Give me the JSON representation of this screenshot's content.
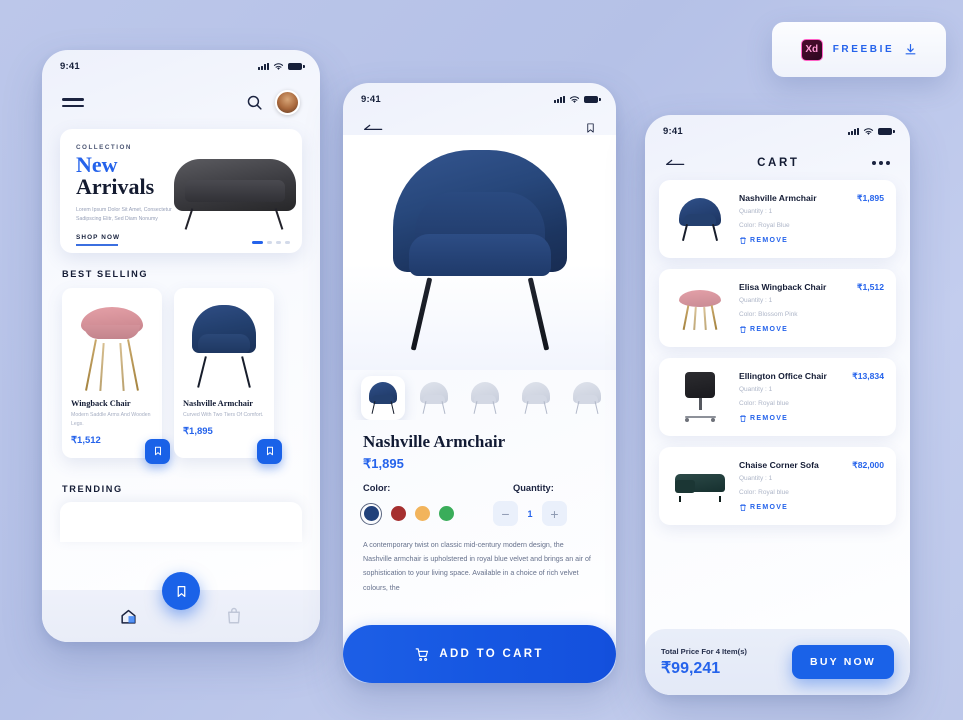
{
  "badge": {
    "app_icon_label": "Xd",
    "label": "FREEBIE",
    "download_icon": "download-icon"
  },
  "home": {
    "status": {
      "time": "9:41"
    },
    "menu_icon": "hamburger-menu-icon",
    "search_icon": "search-icon",
    "avatar": "user-avatar",
    "banner": {
      "eyebrow": "COLLECTION",
      "title_accent": "New",
      "title_main": "Arrivals",
      "subtitle": "Lorem Ipsum Dolor Sit Amet, Consectetur Sadipscing Elitr, Sed Diam Nonumy",
      "cta": "SHOP NOW",
      "dots": 4,
      "active_dot": 0
    },
    "best_selling_title": "BEST SELLING",
    "products": [
      {
        "name": "Wingback Chair",
        "desc": "Modern Saddle Arms And Wooden Legs.",
        "price": "₹1,512",
        "bookmark_icon": "bookmark-icon"
      },
      {
        "name": "Nashville Armchair",
        "desc": "Curved With Two Tiers Of Comfort.",
        "price": "₹1,895",
        "bookmark_icon": "bookmark-icon"
      }
    ],
    "trending_title": "TRENDING",
    "tabbar": {
      "home_icon": "home-icon",
      "fab_icon": "bookmark-icon",
      "bag_icon": "shopping-bag-icon"
    }
  },
  "detail": {
    "status": {
      "time": "9:41"
    },
    "back_icon": "back-arrow-icon",
    "bookmark_icon": "bookmark-icon",
    "hero_image": "navy-armchair-photo",
    "thumbnails": [
      {
        "name": "thumb-navy",
        "color": "navy",
        "selected": true
      },
      {
        "name": "thumb-grey-1",
        "color": "grey",
        "selected": false
      },
      {
        "name": "thumb-grey-2",
        "color": "grey",
        "selected": false
      },
      {
        "name": "thumb-grey-3",
        "color": "grey",
        "selected": false
      },
      {
        "name": "thumb-grey-4",
        "color": "grey",
        "selected": false
      }
    ],
    "title": "Nashville Armchair",
    "price": "₹1,895",
    "color_label": "Color:",
    "colors": [
      {
        "name": "royal-blue",
        "hex": "#21417a",
        "selected": true
      },
      {
        "name": "brick-red",
        "hex": "#a52f2f",
        "selected": false
      },
      {
        "name": "amber",
        "hex": "#f2b45c",
        "selected": false
      },
      {
        "name": "green",
        "hex": "#3aad5a",
        "selected": false
      }
    ],
    "quantity_label": "Quantity:",
    "quantity_value": "1",
    "minus_label": "−",
    "plus_label": "+",
    "description": "A contemporary twist on classic mid-century modern design, the Nashville armchair is upholstered in royal blue velvet and brings an air of sophistication to your living space. Available in a choice of rich velvet colours, the",
    "cta_label": "ADD TO CART",
    "cta_icon": "shopping-cart-icon"
  },
  "cart": {
    "status": {
      "time": "9:41"
    },
    "back_icon": "back-arrow-icon",
    "title": "CART",
    "more_icon": "more-options-icon",
    "remove_label": "REMOVE",
    "trash_icon": "trash-icon",
    "items": [
      {
        "name": "Nashville Armchair",
        "price": "₹1,895",
        "quantity": "Quantity : 1",
        "color": "Color: Royal Blue",
        "thumb": "navy-armchair-thumb"
      },
      {
        "name": "Elisa Wingback Chair",
        "price": "₹1,512",
        "quantity": "Quantity : 1",
        "color": "Color: Blossom Pink",
        "thumb": "pink-chair-thumb"
      },
      {
        "name": "Ellington Office Chair",
        "price": "₹13,834",
        "quantity": "Quantity : 1",
        "color": "Color: Royal blue",
        "thumb": "office-chair-thumb"
      },
      {
        "name": "Chaise Corner Sofa",
        "price": "₹82,000",
        "quantity": "Quantity : 1",
        "color": "Color: Royal blue",
        "thumb": "corner-sofa-thumb"
      }
    ],
    "total_label": "Total Price For 4 Item(s)",
    "total_value": "₹99,241",
    "buy_label": "BUY NOW"
  },
  "theme": {
    "accent": "#1a62e8",
    "background": "#bcc7ea",
    "navy": "#21417a"
  }
}
